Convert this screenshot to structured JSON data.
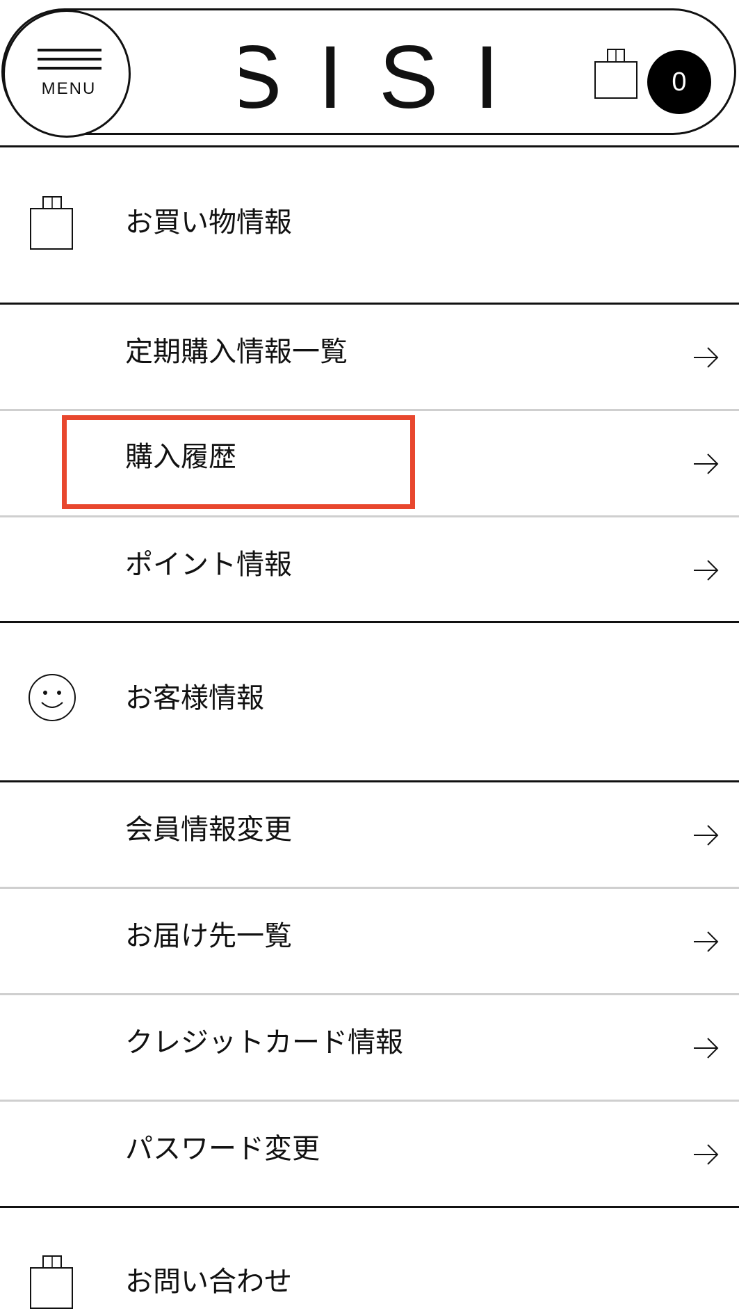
{
  "header": {
    "menu_label": "MENU",
    "logo_text": "SISI",
    "cart_count": "0"
  },
  "sections": {
    "shopping": {
      "title": "お買い物情報",
      "icon": "shopping-bag-icon",
      "items": [
        {
          "label": "定期購入情報一覧"
        },
        {
          "label": "購入履歴"
        },
        {
          "label": "ポイント情報"
        }
      ]
    },
    "customer": {
      "title": "お客様情報",
      "icon": "smiley-face-icon",
      "items": [
        {
          "label": "会員情報変更"
        },
        {
          "label": "お届け先一覧"
        },
        {
          "label": "クレジットカード情報"
        },
        {
          "label": "パスワード変更"
        }
      ]
    },
    "contact": {
      "title": "お問い合わせ",
      "icon": "shopping-bag-icon"
    }
  },
  "colors": {
    "highlight": "#e8472e",
    "text": "#111111",
    "divider_thin": "#cfcfcf"
  }
}
